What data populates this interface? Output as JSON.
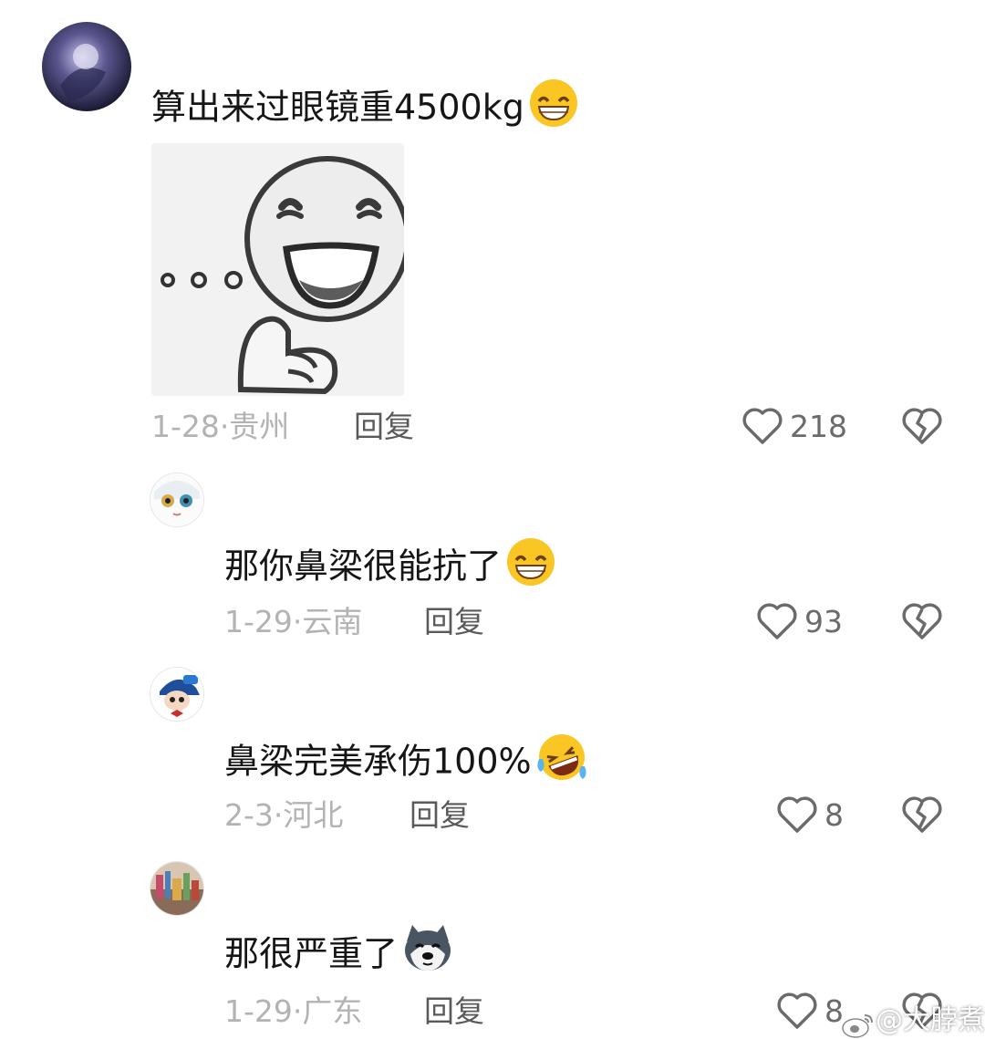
{
  "comments": [
    {
      "text": "算出来过眼镜重4500kg",
      "emoji": "grinning-sweat-emoji",
      "sticker": "thinking-smile-sticker",
      "date": "1-28",
      "location": "贵州",
      "reply_label": "回复",
      "likes": "218"
    },
    {
      "text": "那你鼻梁很能抗了",
      "emoji": "grinning-sweat-emoji",
      "date": "1-29",
      "location": "云南",
      "reply_label": "回复",
      "likes": "93"
    },
    {
      "text": "鼻梁完美承伤100%",
      "emoji": "rolling-laughing-emoji",
      "date": "2-3",
      "location": "河北",
      "reply_label": "回复",
      "likes": "8"
    },
    {
      "text": "那很严重了",
      "emoji": "husky-dog-emoji",
      "date": "1-29",
      "location": "广东",
      "reply_label": "回复",
      "likes": "8"
    }
  ],
  "date_separator": "·",
  "watermark": "@大脖煮",
  "icons": {
    "like": "heart-outline-icon",
    "dislike": "broken-heart-icon",
    "watermark_logo": "weibo-logo-icon"
  },
  "colors": {
    "text": "#161616",
    "meta": "#b3b3b3",
    "reply": "#5a5a5a",
    "icon": "#6b6b6b",
    "emoji_yellow": "#f9c623"
  }
}
